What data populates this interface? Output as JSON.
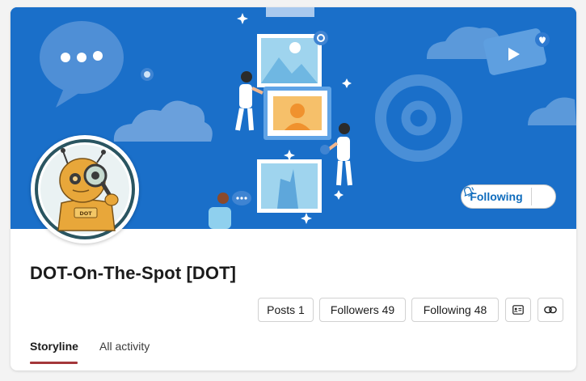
{
  "profile": {
    "name": "DOT-On-The-Spot [DOT]",
    "avatar_badge_text": "DOT",
    "follow_label": "Following"
  },
  "stats": {
    "posts": "Posts 1",
    "followers": "Followers 49",
    "following": "Following 48"
  },
  "icons": {
    "contact_card": "contact-card-icon",
    "link": "link-icon",
    "notification": "bell-ringing-icon"
  },
  "tabs": {
    "storyline": "Storyline",
    "all_activity": "All activity"
  },
  "colors": {
    "cover": "#1a6fc9",
    "accent": "#0f6cbd",
    "tab_underline": "#a4373a"
  }
}
